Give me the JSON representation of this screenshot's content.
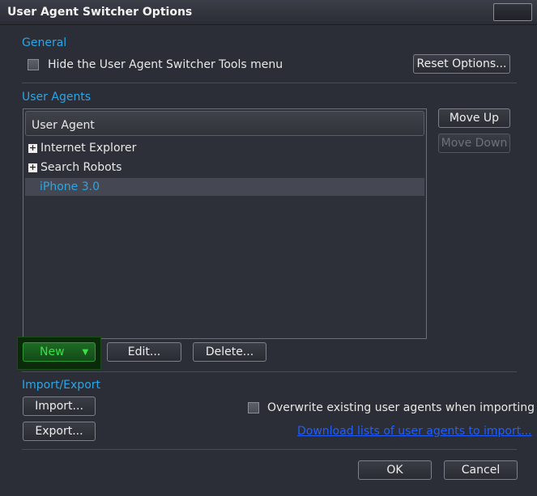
{
  "window": {
    "title": "User Agent Switcher Options"
  },
  "general": {
    "section_label": "General",
    "hide_menu_label": "Hide the User Agent Switcher Tools menu",
    "hide_menu_checked": false,
    "reset_button": "Reset Options..."
  },
  "user_agents": {
    "section_label": "User Agents",
    "column_header": "User Agent",
    "items": [
      {
        "label": "Internet Explorer",
        "type": "folder",
        "selected": false
      },
      {
        "label": "Search Robots",
        "type": "folder",
        "selected": false
      },
      {
        "label": "iPhone 3.0",
        "type": "item",
        "selected": true
      }
    ],
    "move_up_button": "Move Up",
    "move_down_button": "Move Down",
    "move_down_enabled": false,
    "new_button": "New",
    "edit_button": "Edit...",
    "delete_button": "Delete..."
  },
  "import_export": {
    "section_label": "Import/Export",
    "import_button": "Import...",
    "export_button": "Export...",
    "overwrite_label": "Overwrite existing user agents when importing",
    "overwrite_checked": false,
    "download_link": "Download lists of user agents to import..."
  },
  "footer": {
    "ok_button": "OK",
    "cancel_button": "Cancel"
  },
  "colors": {
    "background": "#2b2e36",
    "section_label": "#2aa6e6",
    "selected_text": "#2aa6e6",
    "new_button_text": "#38e04a",
    "link": "#1f5fff"
  }
}
